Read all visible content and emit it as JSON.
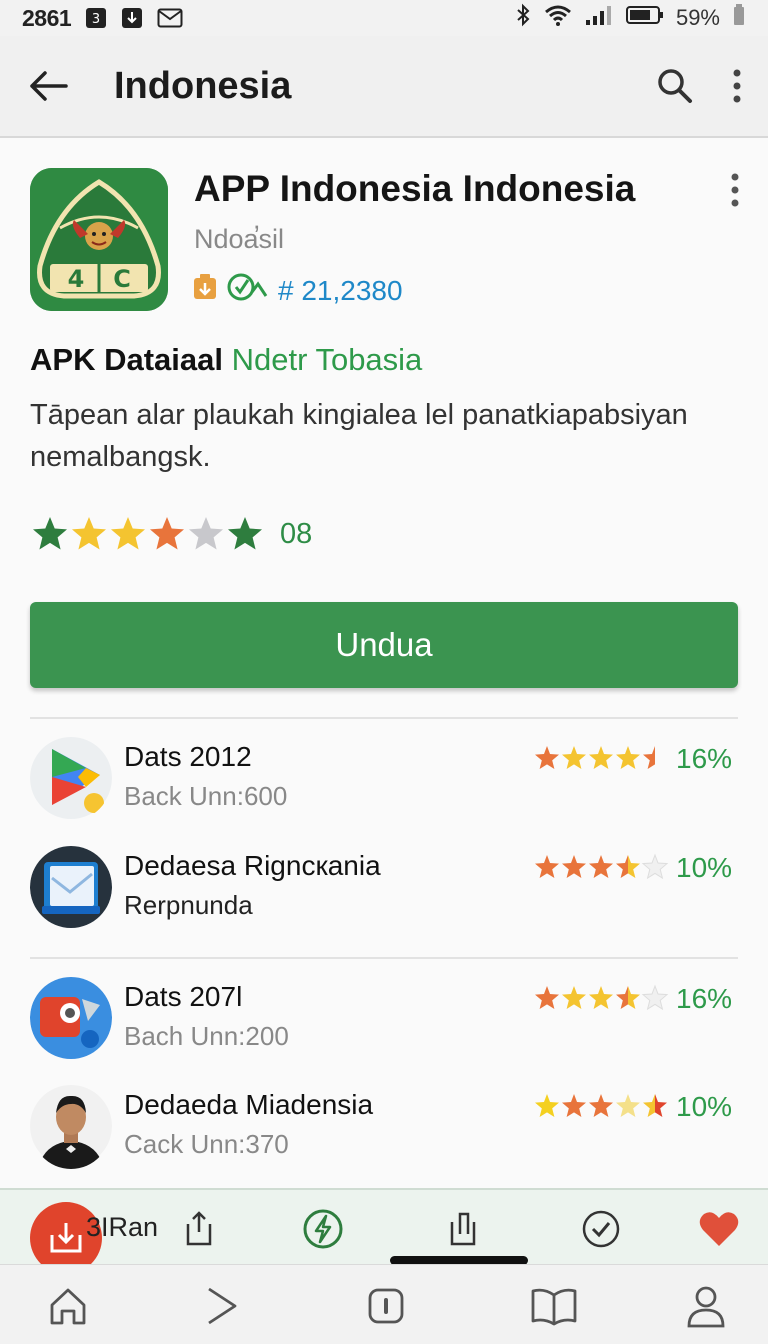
{
  "status_bar": {
    "time": "2861",
    "battery": "59%"
  },
  "app_bar": {
    "title": "Indonesia"
  },
  "app": {
    "name": "APP Indonesia Indonesia",
    "subtitle": "Ndoa̕sil",
    "meta_count": "# 21,2380",
    "section_title": "APK Dataiaal",
    "section_accent": "Ndetr Tobasia",
    "description": "Tāpean alar plaukah kingialeа lel panatkiapabsiyan nemalbangsk.",
    "rating_count": "08",
    "download_label": "Undua"
  },
  "list": [
    {
      "title": "Dats 2012",
      "subtitle": "Back Unn:600",
      "percent": "16%",
      "stars": 4.5
    },
    {
      "title": "Dedaesa Rigncкania",
      "subtitle": "Rerpnunda",
      "percent": "10%",
      "stars": 3.5
    },
    {
      "title": "Dats 207l",
      "subtitle": "Bach Unn:200",
      "percent": "16%",
      "stars": 3.5
    },
    {
      "title": "Dedaeda Miadensia",
      "subtitle": "Cack Unn:370",
      "percent": "10%",
      "stars": 3.5
    }
  ],
  "action_bar": {
    "fab_label": "3IRan"
  },
  "icons": {
    "back": "arrow-left-icon",
    "search": "search-icon",
    "more": "more-vert-icon",
    "nav": [
      "home-icon",
      "chevron-right-icon",
      "square-icon",
      "book-icon",
      "person-icon"
    ]
  },
  "colors": {
    "primary_green": "#3b9450",
    "accent_green": "#2e9a4a",
    "link_blue": "#1e88c8",
    "star_gold": "#f4c430",
    "star_orange": "#e8743b",
    "fab_red": "#e0442c"
  }
}
